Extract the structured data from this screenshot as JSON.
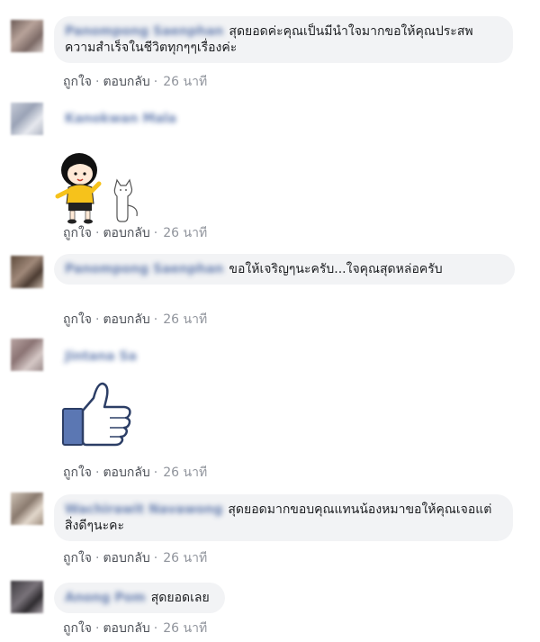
{
  "comments": [
    {
      "author": "Panompong Saenphan",
      "text": "สุดยอดค่ะคุณเป็นมีนำใจมากขอให้คุณประสพความสำเร็จในชีวิตทุกๆๆเรื่องค่ะ",
      "like": "ถูกใจ",
      "reply": "ตอบกลับ",
      "time": "26 นาที"
    },
    {
      "author": "Kanokwan Mala",
      "sticker": "cartoon-girl-and-cat-sticker",
      "like": "ถูกใจ",
      "reply": "ตอบกลับ",
      "time": "26 นาที"
    },
    {
      "author": "Panompong Saenphan",
      "text": "ขอให้เจริญๆนะครับ...ใจคุณสุดหล่อครับ",
      "like": "ถูกใจ",
      "reply": "ตอบกลับ",
      "time": "26 นาที"
    },
    {
      "author": "Jintana Sa",
      "sticker": "thumbs-up-sticker",
      "like": "ถูกใจ",
      "reply": "ตอบกลับ",
      "time": "26 นาที"
    },
    {
      "author": "Wachirawit Navawong",
      "text": "สุดยอดมากขอบคุณแทนน้องหมาขอให้คุณเจอแต่สิ่งดีๆนะคะ",
      "like": "ถูกใจ",
      "reply": "ตอบกลับ",
      "time": "26 นาที"
    },
    {
      "author": "Anong Pom",
      "text": "สุดยอดเลย",
      "like": "ถูกใจ",
      "reply": "ตอบกลับ",
      "time": "26 นาที"
    }
  ],
  "separator": "·",
  "colors": {
    "bubble": "#f2f3f5",
    "name": "#385898",
    "thumb_blue": "#5b77b3"
  }
}
